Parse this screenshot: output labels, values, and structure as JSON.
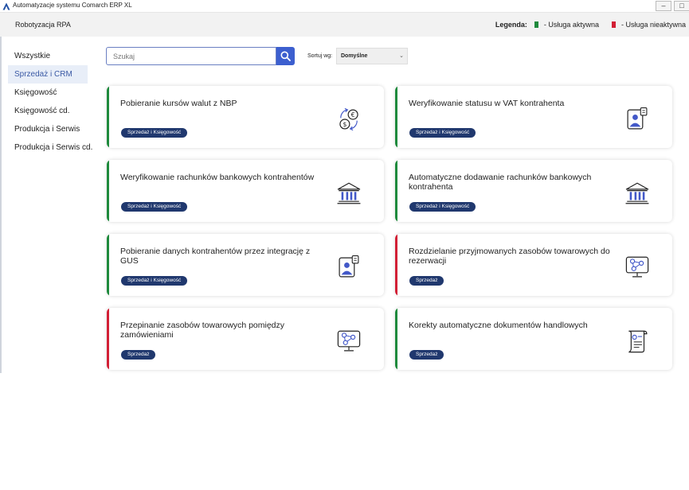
{
  "window": {
    "title": "Automatyzacje systemu Comarch ERP XL",
    "minimize": "–",
    "maximize": "□"
  },
  "app": {
    "name": "Robotyzacja RPA"
  },
  "legend": {
    "title": "Legenda:",
    "active_label": "- Usługa aktywna",
    "inactive_label": "- Usługa nieaktywna",
    "active_color": "#1e8a3c",
    "inactive_color": "#d21f35"
  },
  "sidebar": {
    "items": [
      {
        "label": "Wszystkie",
        "active": false
      },
      {
        "label": "Sprzedaż i CRM",
        "active": true
      },
      {
        "label": "Księgowość",
        "active": false
      },
      {
        "label": "Księgowość cd.",
        "active": false
      },
      {
        "label": "Produkcja i Serwis",
        "active": false
      },
      {
        "label": "Produkcja i Serwis cd.",
        "active": false
      }
    ]
  },
  "search": {
    "placeholder": "Szukaj",
    "value": "",
    "icon": "search-icon"
  },
  "sort": {
    "label": "Sortuj wg:",
    "value": "Domyślne",
    "icon": "chevron-down-icon"
  },
  "cards": [
    {
      "title": "Pobieranie kursów walut z NBP",
      "tag": "Sprzedaż i Księgowość",
      "status": "active",
      "icon": "currency-exchange-icon"
    },
    {
      "title": "Weryfikowanie statusu w VAT kontrahenta",
      "tag": "Sprzedaż i Księgowość",
      "status": "active",
      "icon": "person-document-icon"
    },
    {
      "title": "Weryfikowanie rachunków bankowych kontrahentów",
      "tag": "Sprzedaż i Księgowość",
      "status": "active",
      "icon": "bank-icon"
    },
    {
      "title": "Automatyczne dodawanie rachunków bankowych kontrahenta",
      "tag": "Sprzedaż i Księgowość",
      "status": "active",
      "icon": "bank-icon"
    },
    {
      "title": "Pobieranie danych kontrahentów przez integrację z GUS",
      "tag": "Sprzedaż i Księgowość",
      "status": "active",
      "icon": "person-document-icon"
    },
    {
      "title": "Rozdzielanie przyjmowanych zasobów towarowych do rezerwacji",
      "tag": "Sprzedaż",
      "status": "inactive",
      "icon": "network-monitor-icon"
    },
    {
      "title": "Przepinanie zasobów towarowych pomiędzy zamówieniami",
      "tag": "Sprzedaż",
      "status": "inactive",
      "icon": "network-monitor-icon"
    },
    {
      "title": "Korekty automatyczne dokumentów handlowych",
      "tag": "Sprzedaż",
      "status": "active",
      "icon": "document-scroll-icon"
    }
  ]
}
